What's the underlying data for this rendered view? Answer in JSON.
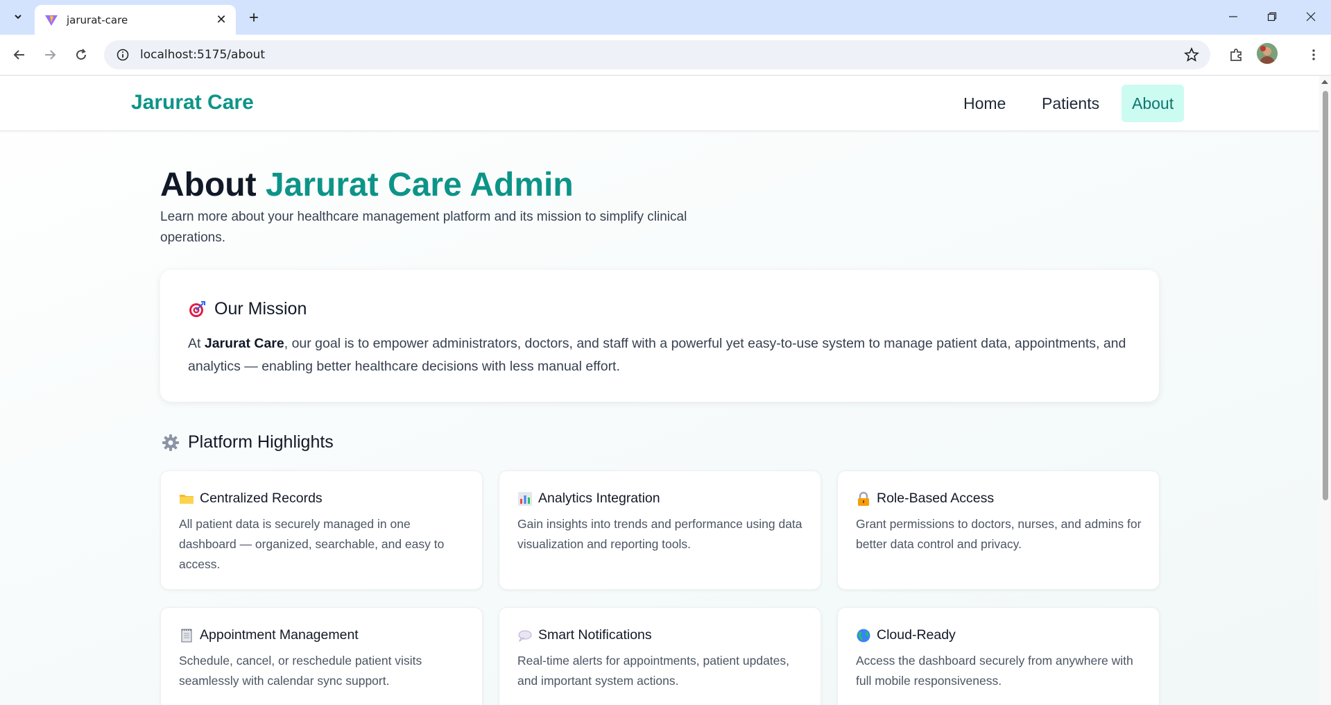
{
  "browser": {
    "tab_title": "jarurat-care",
    "url": "localhost:5175/about"
  },
  "navbar": {
    "brand": "Jarurat Care",
    "links": [
      {
        "label": "Home",
        "active": false
      },
      {
        "label": "Patients",
        "active": false
      },
      {
        "label": "About",
        "active": true
      }
    ],
    "accent_color": "#0d9488"
  },
  "hero": {
    "title_prefix": "About",
    "title_accent": "Jarurat Care Admin",
    "subtitle": "Learn more about your healthcare management platform and its mission to simplify clinical operations."
  },
  "mission": {
    "icon": "target-icon",
    "title": "Our Mission",
    "text_before": "At ",
    "text_bold": "Jarurat Care",
    "text_after": ", our goal is to empower administrators, doctors, and staff with a powerful yet easy-to-use system to manage patient data, appointments, and analytics — enabling better healthcare decisions with less manual effort."
  },
  "highlights": {
    "icon": "gear-icon",
    "title": "Platform Highlights",
    "cards": [
      {
        "icon": "folder-icon",
        "title": "Centralized Records",
        "desc": "All patient data is securely managed in one dashboard — organized, searchable, and easy to access."
      },
      {
        "icon": "bar-chart-icon",
        "title": "Analytics Integration",
        "desc": "Gain insights into trends and performance using data visualization and reporting tools."
      },
      {
        "icon": "lock-icon",
        "title": "Role-Based Access",
        "desc": "Grant permissions to doctors, nurses, and admins for better data control and privacy."
      },
      {
        "icon": "calendar-icon",
        "title": "Appointment Management",
        "desc": "Schedule, cancel, or reschedule patient visits seamlessly with calendar sync support."
      },
      {
        "icon": "speech-bubble-icon",
        "title": "Smart Notifications",
        "desc": "Real-time alerts for appointments, patient updates, and important system actions."
      },
      {
        "icon": "globe-icon",
        "title": "Cloud-Ready",
        "desc": "Access the dashboard securely from anywhere with full mobile responsiveness."
      }
    ]
  }
}
